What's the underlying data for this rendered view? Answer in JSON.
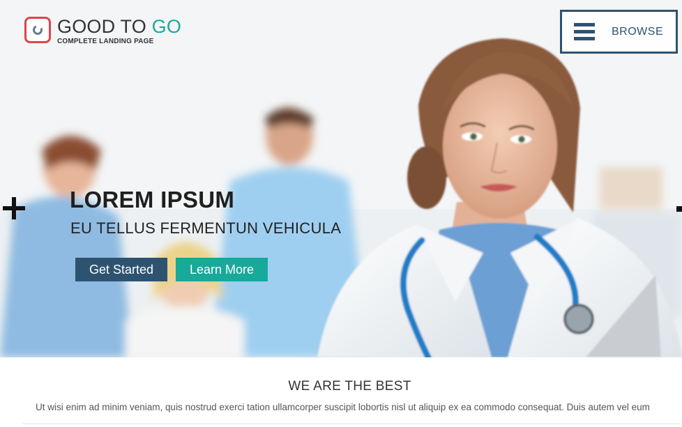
{
  "brand": {
    "title_main": "GOOD TO ",
    "title_accent": "GO",
    "subtitle": "COMPLETE LANDING PAGE",
    "accent_color": "#17a99a",
    "mark_color": "#e0434b"
  },
  "nav": {
    "browse_label": "BROWSE",
    "color": "#2d5371"
  },
  "hero": {
    "title": "LOREM IPSUM",
    "subtitle": "EU TELLUS FERMENTUN VEHICULA",
    "primary_button": "Get Started",
    "secondary_button": "Learn More",
    "prev_icon": "plus-arrow-icon",
    "next_icon": "square-dot-icon"
  },
  "section": {
    "title": "WE ARE THE BEST",
    "text": "Ut wisi enim ad minim veniam, quis nostrud exerci tation ullamcorper suscipit lobortis nisl ut aliquip ex ea commodo consequat. Duis autem vel eum"
  }
}
